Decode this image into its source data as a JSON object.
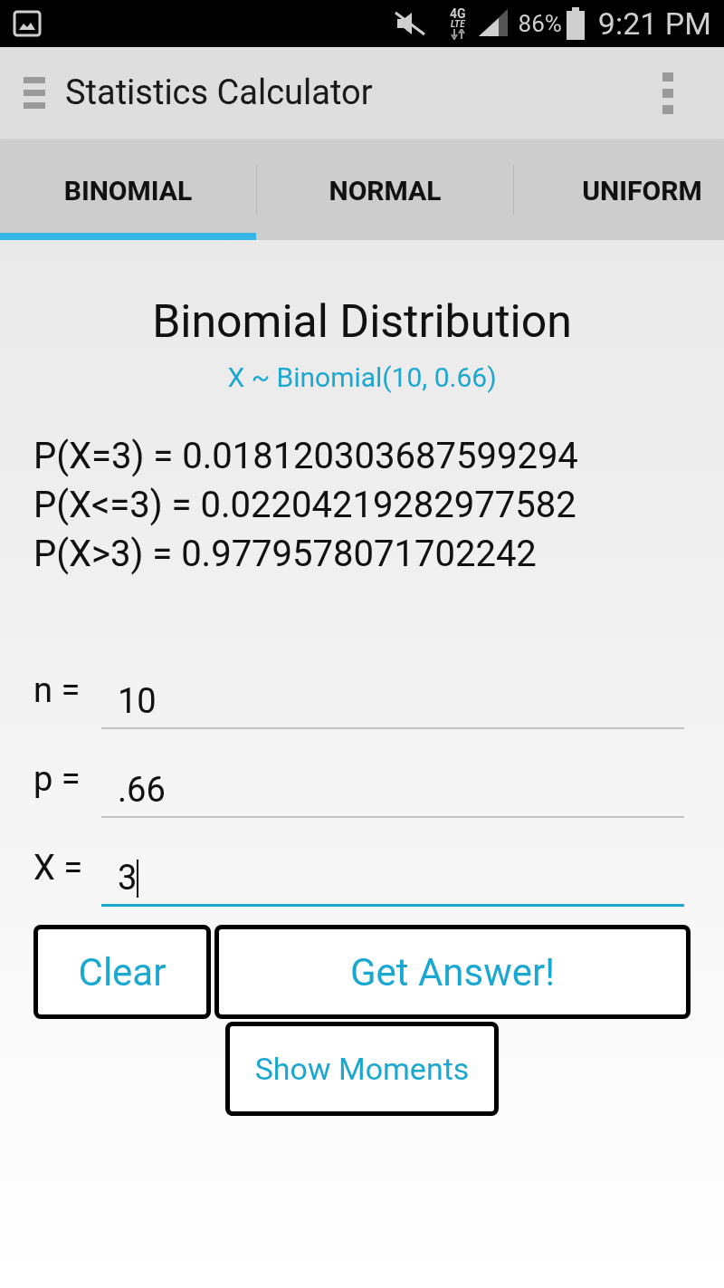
{
  "status_bar": {
    "network": [
      "4G",
      "LTE"
    ],
    "battery": "86%",
    "time": "9:21 PM"
  },
  "app_bar": {
    "title": "Statistics Calculator"
  },
  "tabs": [
    {
      "label": "BINOMIAL",
      "selected": true
    },
    {
      "label": "NORMAL",
      "selected": false
    },
    {
      "label": "UNIFORM",
      "selected": false
    }
  ],
  "heading": "Binomial Distribution",
  "subtitle": "X ~ Binomial(10, 0.66)",
  "results": [
    "P(X=3) = 0.018120303687599294",
    "P(X<=3) = 0.02204219282977582",
    "P(X>3) = 0.9779578071702242"
  ],
  "fields": [
    {
      "label": "n =",
      "value": "10",
      "focused": false
    },
    {
      "label": "p =",
      "value": ".66",
      "focused": false
    },
    {
      "label": "X =",
      "value": "3",
      "focused": true
    }
  ],
  "buttons": [
    "Clear",
    "Get Answer!"
  ],
  "moments_button": "Show Moments"
}
